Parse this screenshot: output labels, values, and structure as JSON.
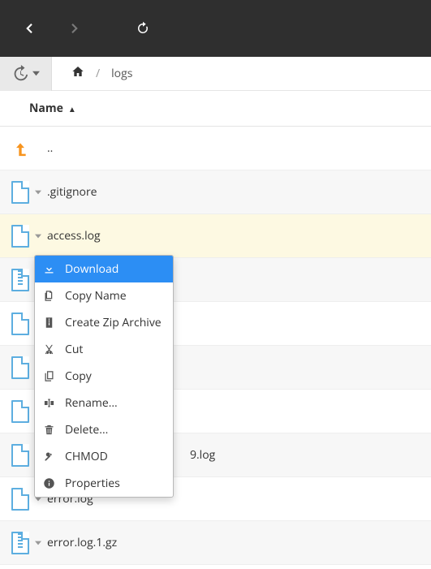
{
  "breadcrumb": {
    "separator": "/",
    "current": "logs"
  },
  "columns": {
    "name": "Name",
    "sort_indicator": "▲"
  },
  "up_label": "..",
  "files": [
    {
      "name": ".gitignore",
      "type": "file"
    },
    {
      "name": "access.log",
      "type": "file"
    },
    {
      "name": "",
      "type": "zip"
    },
    {
      "name": "",
      "type": "file"
    },
    {
      "name": "",
      "type": "file"
    },
    {
      "name": "",
      "type": "file"
    },
    {
      "name": "9.log",
      "type": "file",
      "partial_prefix": true
    },
    {
      "name": "error.log",
      "type": "file"
    },
    {
      "name": "error.log.1.gz",
      "type": "zip"
    }
  ],
  "context_menu": [
    {
      "label": "Download",
      "icon": "download"
    },
    {
      "label": "Copy Name",
      "icon": "copy-name"
    },
    {
      "label": "Create Zip Archive",
      "icon": "zip"
    },
    {
      "label": "Cut",
      "icon": "cut"
    },
    {
      "label": "Copy",
      "icon": "copy"
    },
    {
      "label": "Rename...",
      "icon": "rename"
    },
    {
      "label": "Delete...",
      "icon": "delete"
    },
    {
      "label": "CHMOD",
      "icon": "chmod"
    },
    {
      "label": "Properties",
      "icon": "properties"
    }
  ],
  "context_menu_selected_index": 0
}
